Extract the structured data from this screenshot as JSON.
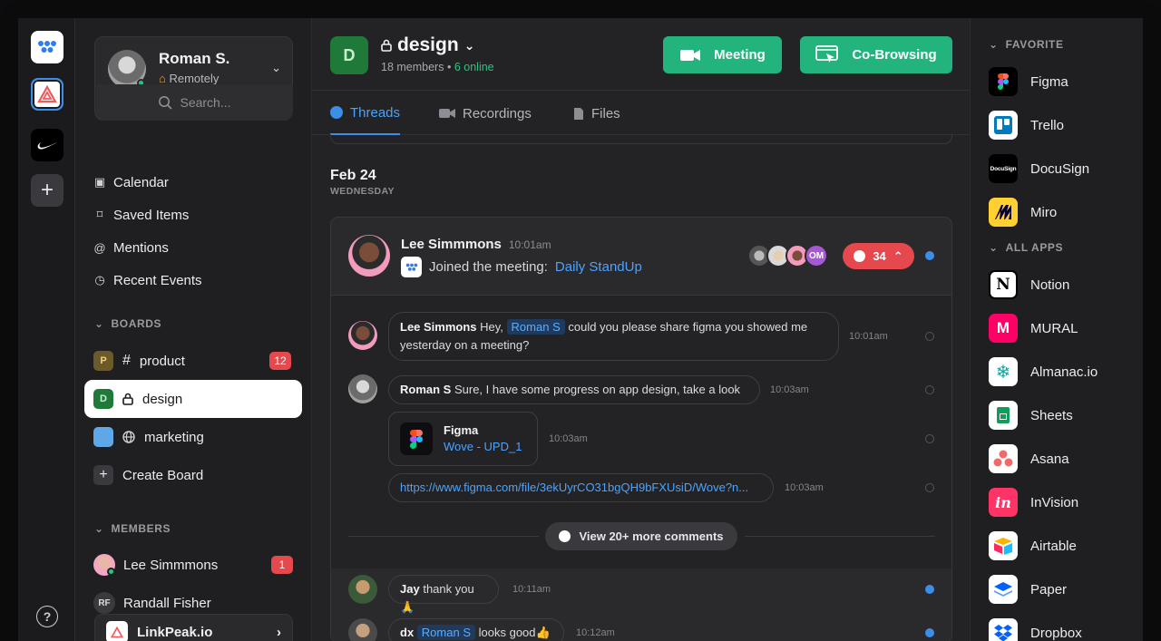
{
  "user": {
    "name": "Roman S.",
    "status": "Remotely",
    "status_icon": "home-icon"
  },
  "search": {
    "placeholder": "Search..."
  },
  "nav": [
    {
      "label": "Calendar",
      "icon": "calendar-icon"
    },
    {
      "label": "Saved Items",
      "icon": "bookmark-icon"
    },
    {
      "label": "Mentions",
      "icon": "at-icon"
    },
    {
      "label": "Recent Events",
      "icon": "clock-icon"
    }
  ],
  "boards": {
    "title": "BOARDS",
    "items": [
      {
        "initial": "P",
        "prefix": "#",
        "label": "product",
        "badge": "12"
      },
      {
        "initial": "D",
        "prefix": "lock",
        "label": "design",
        "active": true
      },
      {
        "initial": "",
        "prefix": "globe",
        "label": "marketing"
      }
    ],
    "create_label": "Create Board"
  },
  "members": {
    "title": "MEMBERS",
    "items": [
      {
        "name": "Lee Simmmons",
        "badge": "1"
      },
      {
        "name": "Randall Fisher",
        "initials": "RF"
      }
    ]
  },
  "workspace": {
    "name": "LinkPeak.io"
  },
  "channel": {
    "initial": "D",
    "name": "design",
    "members": "18 members",
    "separator": "•",
    "online": "6 online"
  },
  "buttons": {
    "meeting": "Meeting",
    "cobrowsing": "Co-Browsing"
  },
  "tabs": [
    {
      "label": "Threads",
      "active": true
    },
    {
      "label": "Recordings"
    },
    {
      "label": "Files"
    }
  ],
  "date": {
    "day": "Feb 24",
    "weekday": "WEDNESDAY"
  },
  "thread": {
    "author": "Lee Simmmons",
    "time": "10:01am",
    "text": "Joined the meeting:",
    "link": "Daily StandUp",
    "stack_extra": "OM",
    "comment_count": "34"
  },
  "messages": [
    {
      "author": "Lee Simmons",
      "pre": "Hey,",
      "mention": "Roman S",
      "text": "could you please share figma you showed me",
      "text2": "yesterday on a meeting?",
      "time": "10:01am"
    },
    {
      "author": "Roman S",
      "text": "Sure, I have some progress on app design, take a look",
      "time": "10:03am"
    },
    {
      "file_title": "Figma",
      "file_name": "Wove - UPD_1",
      "time": "10:03am"
    },
    {
      "url": "https://www.figma.com/file/3ekUyrCO31bgQH9bFXUsiD/Wove?n...",
      "time": "10:03am"
    }
  ],
  "more_comments": "View 20+ more comments",
  "replies": [
    {
      "author": "Jay",
      "text": "thank you 🙏",
      "time": "10:11am"
    },
    {
      "author": "dx",
      "mention": "Roman S",
      "text": "looks good👍",
      "time": "10:12am"
    }
  ],
  "apps": {
    "favorite_title": "FAVORITE",
    "favorites": [
      {
        "name": "Figma",
        "color": "#000000"
      },
      {
        "name": "Trello",
        "color": "#0079bf"
      },
      {
        "name": "DocuSign",
        "color": "#000000",
        "logo_text": "DocuSign"
      },
      {
        "name": "Miro",
        "color": "#ffd02f"
      }
    ],
    "all_title": "ALL APPS",
    "all": [
      {
        "name": "Notion",
        "color": "#ffffff"
      },
      {
        "name": "MURAL",
        "color": "#ff0066"
      },
      {
        "name": "Almanac.io",
        "color": "#ffffff"
      },
      {
        "name": "Sheets",
        "color": "#ffffff"
      },
      {
        "name": "Asana",
        "color": "#ffffff"
      },
      {
        "name": "InVision",
        "color": "#ff3366"
      },
      {
        "name": "Airtable",
        "color": "#ffffff"
      },
      {
        "name": "Paper",
        "color": "#ffffff"
      },
      {
        "name": "Dropbox",
        "color": "#ffffff"
      }
    ]
  },
  "colors": {
    "accent_green": "#23b47e",
    "accent_blue": "#3b8eea",
    "alert_red": "#e5484d"
  }
}
